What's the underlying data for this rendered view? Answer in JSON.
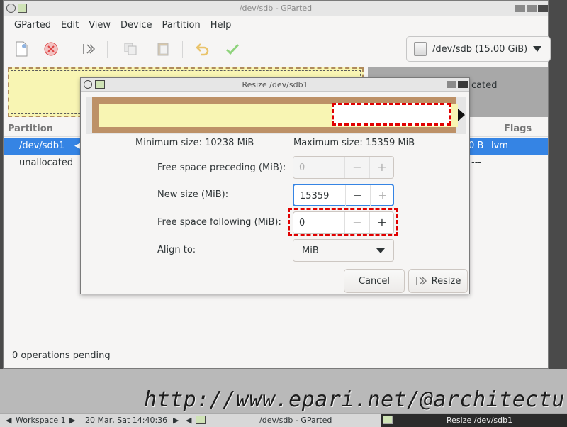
{
  "main_window": {
    "title": "/dev/sdb - GParted",
    "menu": [
      "GParted",
      "Edit",
      "View",
      "Device",
      "Partition",
      "Help"
    ],
    "toolbar_icons": [
      "new-icon",
      "delete-icon",
      "resize-move-icon",
      "copy-icon",
      "paste-icon",
      "undo-icon",
      "apply-icon"
    ],
    "device_selector": "/dev/sdb  (15.00 GiB)",
    "graph_unallocated_label": "cated",
    "columns": {
      "partition": "Partition",
      "flags": "Flags"
    },
    "rows": [
      {
        "partition": "/dev/sdb1",
        "mark": "◀",
        "size_tail": "0 B",
        "flags": "lvm"
      },
      {
        "partition": "unallocated",
        "flags": "---"
      }
    ],
    "status": "0 operations pending"
  },
  "dialog": {
    "title": "Resize /dev/sdb1",
    "minimum_size": "Minimum size: 10238 MiB",
    "maximum_size": "Maximum size: 15359 MiB",
    "free_preceding": {
      "label": "Free space preceding (MiB):",
      "value": "0",
      "minus": "−",
      "plus": "+"
    },
    "new_size": {
      "label": "New size (MiB):",
      "value": "15359",
      "minus": "−",
      "plus": "+"
    },
    "free_following": {
      "label": "Free space following (MiB):",
      "value": "0",
      "minus": "−",
      "plus": "+"
    },
    "align_to": {
      "label": "Align to:",
      "value": "MiB"
    },
    "cancel_label": "Cancel",
    "resize_label": "Resize"
  },
  "taskbar": {
    "workspace": "Workspace 1",
    "datetime": "20 Mar, Sat 14:40:36",
    "task1": "/dev/sdb - GParted",
    "task2": "Resize /dev/sdb1"
  },
  "watermark": "http://www.epari.net/@architecture"
}
